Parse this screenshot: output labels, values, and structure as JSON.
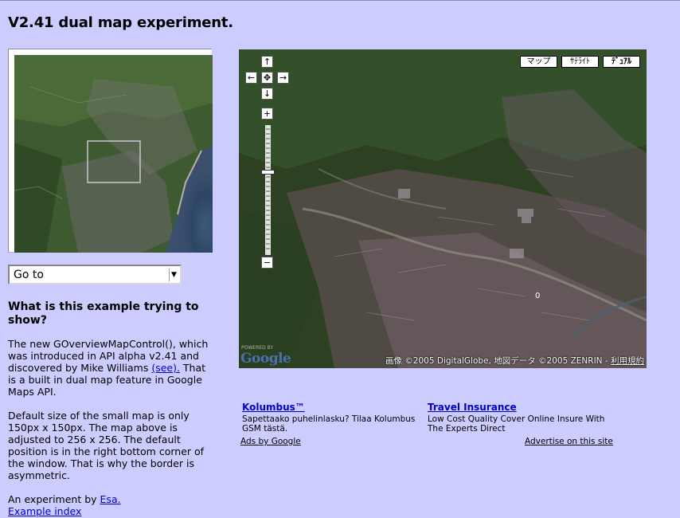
{
  "page": {
    "title": "V2.41 dual map experiment."
  },
  "goto": {
    "selected": "Go to"
  },
  "main_map": {
    "type_buttons": [
      "マップ",
      "ｻﾃﾗｲﾄ",
      "ﾃﾞｭｱﾙ"
    ],
    "active_type": "ﾃﾞｭｱﾙ",
    "copyright": "画像 ©2005 DigitalGlobe, 地図データ ©2005 ZENRIN - ",
    "terms_link": "利用規約",
    "logo_text": "Google",
    "powered_text": "POWERED BY",
    "marker_label": "0"
  },
  "article": {
    "heading": "What is this example trying to show?",
    "p1_text": "The new GOverviewMapControl(), which was introduced in API alpha v2.41 and discovered by Mike Williams ",
    "p1_link": "(see).",
    "p1_tail": " That is a built in dual map feature in Google Maps API.",
    "p2": "Default size of the small map is only 150px x 150px. The map above is adjusted to 256 x 256. The default position is in the right bottom corner of the window. That is why the border is asymmetric.",
    "p3_text": "An experiment by ",
    "p3_link": "Esa.",
    "index_link": "Example index"
  },
  "ads": {
    "items": [
      {
        "title": "Kolumbus™",
        "text": "Sapettaako puhelinlasku? Tilaa Kolumbus GSM tästä."
      },
      {
        "title": "Travel Insurance",
        "text": "Low Cost Quality Cover Online Insure With The Experts Direct"
      }
    ],
    "ads_by": "Ads by Google",
    "advertise": "Advertise on this site"
  },
  "colors": {
    "background": "#ccccff",
    "link": "#0000cc"
  }
}
